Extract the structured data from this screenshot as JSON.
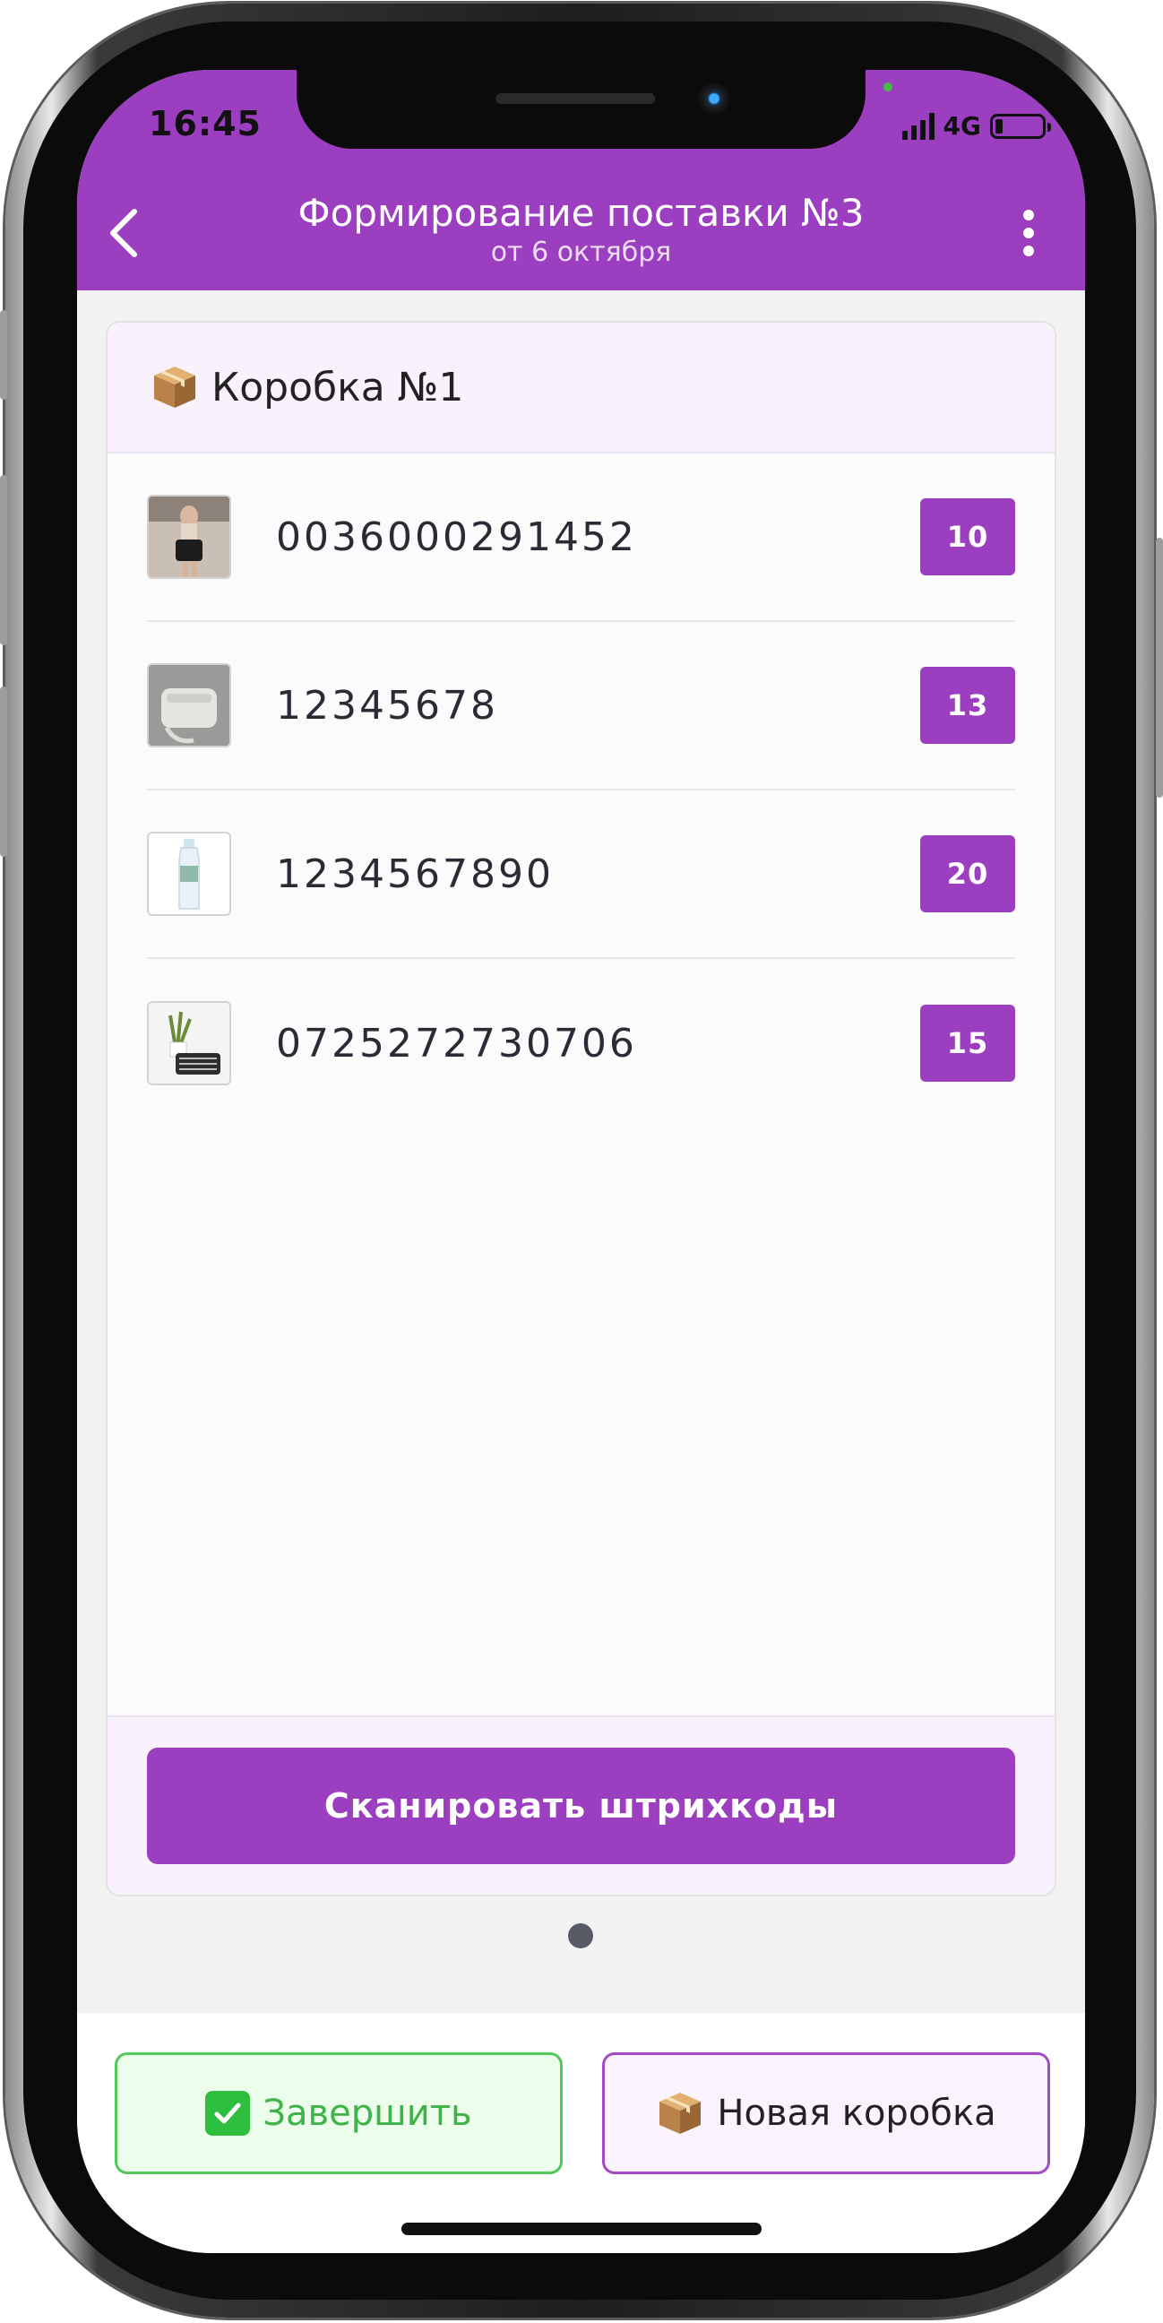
{
  "status_bar": {
    "time": "16:45",
    "network": "4G"
  },
  "header": {
    "title": "Формирование поставки №3",
    "subtitle": "от 6 октября"
  },
  "box": {
    "title": "Коробка №1",
    "items": [
      {
        "barcode": "0036000291452",
        "qty": "10"
      },
      {
        "barcode": "12345678",
        "qty": "13"
      },
      {
        "barcode": "1234567890",
        "qty": "20"
      },
      {
        "barcode": "0725272730706",
        "qty": "15"
      }
    ],
    "scan_label": "Сканировать штрихкоды"
  },
  "bottom": {
    "finish_label": "Завершить",
    "new_box_label": "Новая коробка"
  },
  "colors": {
    "accent": "#9b3ec0",
    "finish_green": "#3fb34a",
    "background": "#f2f2f2"
  }
}
